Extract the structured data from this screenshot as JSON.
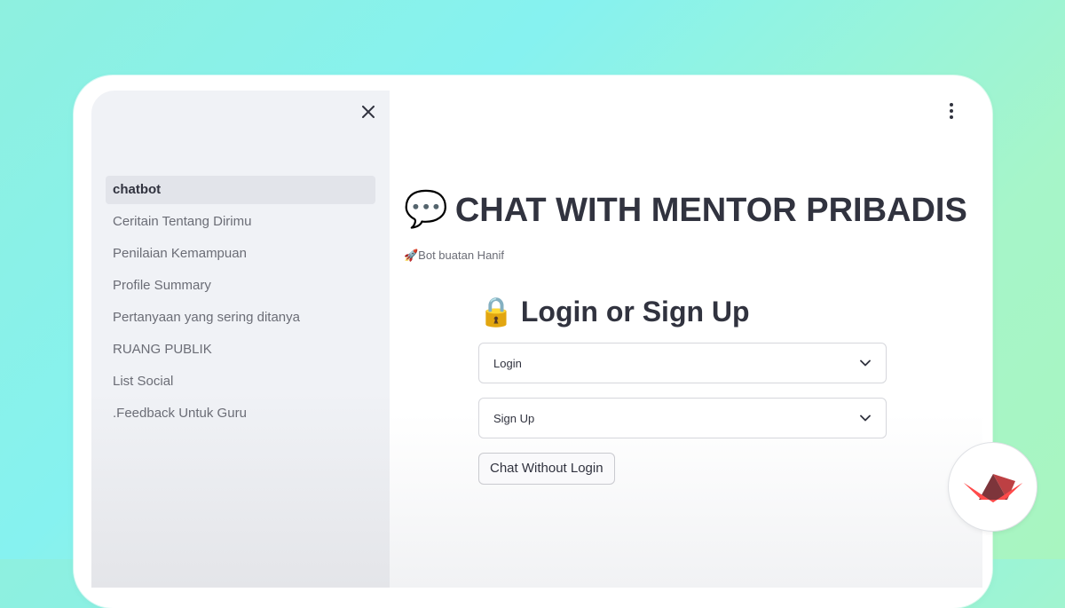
{
  "sidebar": {
    "items": [
      {
        "label": "chatbot"
      },
      {
        "label": "Ceritain Tentang Dirimu"
      },
      {
        "label": "Penilaian Kemampuan"
      },
      {
        "label": "Profile Summary"
      },
      {
        "label": "Pertanyaan yang sering ditanya"
      },
      {
        "label": "RUANG PUBLIK"
      },
      {
        "label": "List Social"
      },
      {
        "label": ".Feedback Untuk Guru"
      }
    ],
    "active_index": 0,
    "close_icon": "close-icon"
  },
  "main": {
    "title_emoji": "💬",
    "title": "CHAT WITH MENTOR PRIBADIS",
    "caption": "🚀Bot buatan Hanif",
    "menu_icon": "kebab-menu-icon"
  },
  "login": {
    "title_emoji": "🔒",
    "title": "Login or Sign Up",
    "expanders": [
      {
        "label": "Login",
        "icon": "chevron-down-icon"
      },
      {
        "label": "Sign Up",
        "icon": "chevron-down-icon"
      }
    ],
    "chat_button": "Chat Without Login"
  },
  "badge": {
    "icon": "streamlit-logo-icon"
  },
  "colors": {
    "brand": "#ff4b4b",
    "brand_dark": "#7d353b",
    "text": "#31333f",
    "muted_text": "#6b6d76",
    "sidebar_bg": "#f0f2f6",
    "background_gradient_start": "#8ef0df",
    "background_gradient_end": "#a8f5c0"
  }
}
